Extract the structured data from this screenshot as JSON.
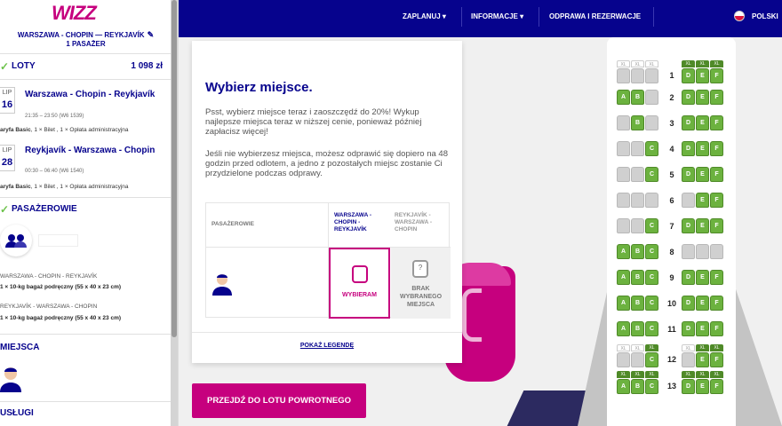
{
  "sidebar": {
    "logo": "WIZZ",
    "route_line1": "WARSZAWA - CHOPIN — REYKJAVÍK",
    "route_line2": "1 PASAŻER",
    "flights": {
      "heading": "LOTY",
      "price": "1 098 zł",
      "items": [
        {
          "month": "LIP",
          "day": "16",
          "title": "Warszawa - Chopin - Reykjavík",
          "time": "21:35 – 23:50 (W6 1539)",
          "fare_name": "aryfa Basic",
          "fare_extra": ", 1 × Bilet , 1 × Opłata administracyjna"
        },
        {
          "month": "LIP",
          "day": "28",
          "title": "Reykjavík - Warszawa - Chopin",
          "time": "00:30 – 06:40 (W6 1540)",
          "fare_name": "aryfa Basic",
          "fare_extra": ", 1 × Bilet , 1 × Opłata administracyjna"
        }
      ]
    },
    "passengers": {
      "heading": "PASAŻEROWIE",
      "rows": [
        {
          "route": "WARSZAWA - CHOPIN - REYKJAVÍK",
          "bag": "1 × 10-kg bagaż podręczny (55 x 40 x 23 cm)"
        },
        {
          "route": "REYKJAVÍK - WARSZAWA - CHOPIN",
          "bag": "1 × 10-kg bagaż podręczny (55 x 40 x 23 cm)"
        }
      ]
    },
    "seats_heading": "MIEJSCA",
    "services_heading": "USŁUGI"
  },
  "nav": {
    "plan": "ZAPLANUJ",
    "info": "INFORMACJE",
    "checkin": "ODPRAWA I REZERWACJE",
    "language": "POLSKI"
  },
  "card": {
    "title": "Wybierz miejsce.",
    "para1": "Psst, wybierz miejsce teraz i zaoszczędź do 20%! Wykup najlepsze miejsca teraz w niższej cenie, ponieważ później zapłacisz więcej!",
    "para2": "Jeśli nie wybierzesz miejsca, możesz odprawić się dopiero na 48 godzin przed odlotem, a jedno z pozostałych miejsc zostanie Ci przydzielone podczas odprawy.",
    "col_passengers": "PASAŻEROWIE",
    "col_outbound": "WARSZAWA - CHOPIN - REYKJAVÍK",
    "col_return": "REYKJAVÍK - WARSZAWA - CHOPIN",
    "select_label": "WYBIERAM",
    "no_seat_label": "BRAK WYBRANEGO MIEJSCA",
    "legend_link": "POKAŻ LEGENDĘ"
  },
  "cta": "PRZEJDŹ DO LOTU POWROTNEGO",
  "seatmap": {
    "xl_label": "XL",
    "rows": [
      {
        "n": "1",
        "xl": true,
        "seats": [
          "t",
          "t",
          "t",
          "a",
          "a",
          "a"
        ]
      },
      {
        "n": "2",
        "xl": false,
        "seats": [
          "a",
          "a",
          "t",
          "a",
          "a",
          "a"
        ]
      },
      {
        "n": "3",
        "xl": false,
        "seats": [
          "t",
          "a",
          "t",
          "a",
          "a",
          "a"
        ]
      },
      {
        "n": "4",
        "xl": false,
        "seats": [
          "t",
          "t",
          "a",
          "a",
          "a",
          "a"
        ]
      },
      {
        "n": "5",
        "xl": false,
        "seats": [
          "t",
          "t",
          "a",
          "a",
          "a",
          "a"
        ]
      },
      {
        "n": "6",
        "xl": false,
        "seats": [
          "t",
          "t",
          "t",
          "t",
          "a",
          "a"
        ]
      },
      {
        "n": "7",
        "xl": false,
        "seats": [
          "t",
          "t",
          "a",
          "a",
          "a",
          "a"
        ]
      },
      {
        "n": "8",
        "xl": false,
        "seats": [
          "a",
          "a",
          "a",
          "t",
          "t",
          "t"
        ]
      },
      {
        "n": "9",
        "xl": false,
        "seats": [
          "a",
          "a",
          "a",
          "a",
          "a",
          "a"
        ]
      },
      {
        "n": "10",
        "xl": false,
        "seats": [
          "a",
          "a",
          "a",
          "a",
          "a",
          "a"
        ]
      },
      {
        "n": "11",
        "xl": false,
        "seats": [
          "a",
          "a",
          "a",
          "a",
          "a",
          "a"
        ]
      },
      {
        "n": "12",
        "xl": true,
        "seats": [
          "t",
          "t",
          "a",
          "t",
          "a",
          "a"
        ]
      },
      {
        "n": "13",
        "xl": true,
        "seats": [
          "a",
          "a",
          "a",
          "a",
          "a",
          "a"
        ]
      }
    ],
    "letters": [
      "A",
      "B",
      "C",
      "D",
      "E",
      "F"
    ]
  }
}
